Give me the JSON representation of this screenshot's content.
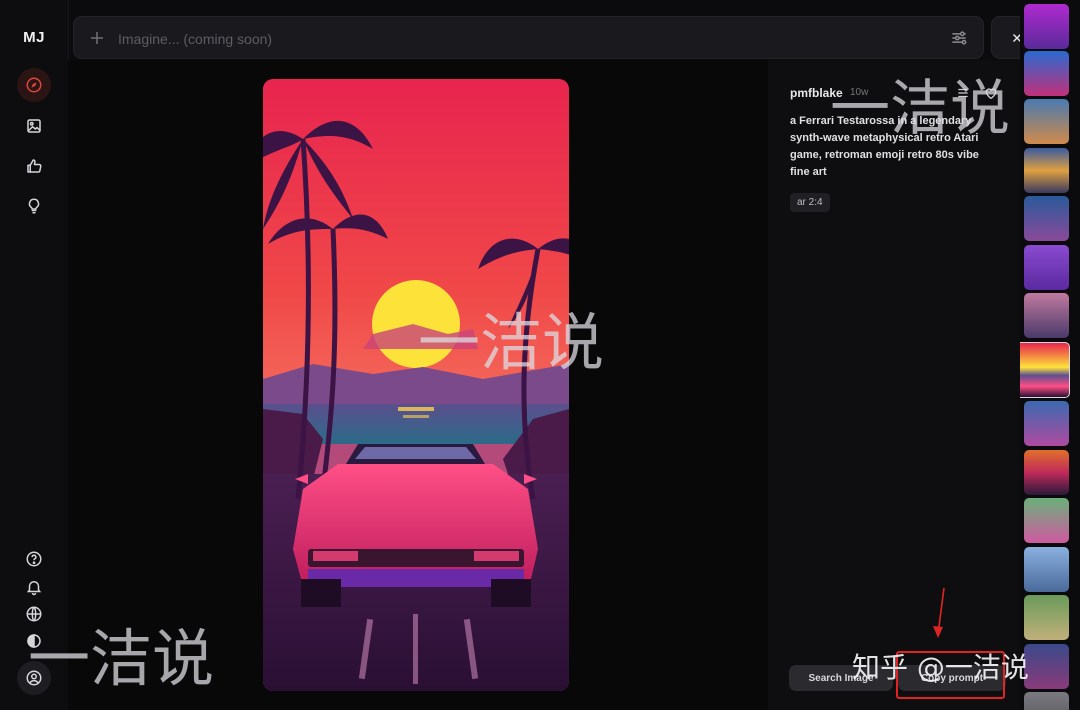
{
  "sidebar": {
    "logo": "MJ",
    "nav": [
      {
        "icon": "compass-icon",
        "active": true
      },
      {
        "icon": "image-icon",
        "active": false
      },
      {
        "icon": "thumbs-up-icon",
        "active": false
      },
      {
        "icon": "lightbulb-icon",
        "active": false
      }
    ],
    "bottom": [
      "help-icon",
      "bell-icon",
      "globe-icon",
      "moon-icon"
    ],
    "accent_color": "#e0453a"
  },
  "prompt_bar": {
    "placeholder": "Imagine... (coming soon)"
  },
  "details": {
    "author": "pmfblake",
    "time": "10w",
    "prompt": "a Ferrari Testarossa in a legendary synth-wave metaphysical retro Atari game, retroman emoji retro 80s vibe fine art",
    "param": "ar 2:4",
    "search_image_label": "Search Image",
    "copy_prompt_label": "Copy prompt",
    "highlight_color": "#e02424"
  },
  "watermarks": {
    "text": "一洁说",
    "credit": "知乎 @一洁说"
  }
}
